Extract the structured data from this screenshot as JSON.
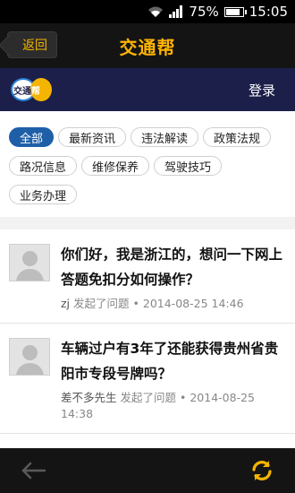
{
  "status_bar": {
    "battery_percent": "75%",
    "battery_level": 0.75,
    "time": "15:05"
  },
  "app_bar": {
    "back_label": "返回",
    "title": "交通帮"
  },
  "brand_bar": {
    "logo_text_left": "交通",
    "logo_text_right": "帮",
    "login_label": "登录"
  },
  "categories": {
    "items": [
      {
        "label": "全部",
        "active": true
      },
      {
        "label": "最新资讯",
        "active": false
      },
      {
        "label": "违法解读",
        "active": false
      },
      {
        "label": "政策法规",
        "active": false
      },
      {
        "label": "路况信息",
        "active": false
      },
      {
        "label": "维修保养",
        "active": false
      },
      {
        "label": "驾驶技巧",
        "active": false
      },
      {
        "label": "业务办理",
        "active": false
      }
    ]
  },
  "questions": [
    {
      "title": "你们好，我是浙江的，想问一下网上答题免扣分如何操作？",
      "user": "zj",
      "action": "发起了问题",
      "time": "2014-08-25 14:46"
    },
    {
      "title": "车辆过户有3年了还能获得贵州省贵阳市专段号牌吗？",
      "user": "差不多先生",
      "action": "发起了问题",
      "time": "2014-08-25 14:38"
    }
  ],
  "colors": {
    "accent": "#ffb400",
    "active_tag": "#1f5fa8",
    "brand_bar": "#1b1f4a"
  },
  "icons": {
    "back_nav": "arrow-left-icon",
    "refresh": "refresh-icon"
  }
}
